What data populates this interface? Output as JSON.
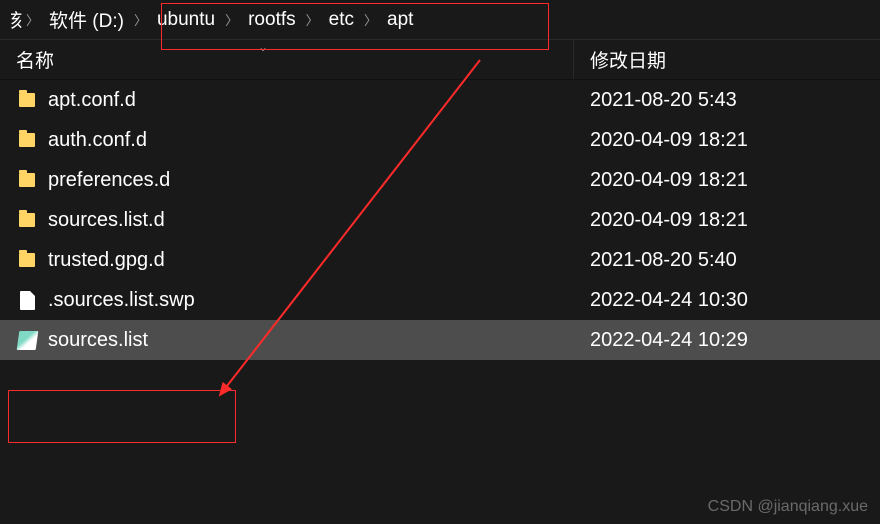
{
  "breadcrumb": {
    "items": [
      "刻",
      "软件 (D:)",
      "ubuntu",
      "rootfs",
      "etc",
      "apt"
    ]
  },
  "columns": {
    "name": "名称",
    "date": "修改日期"
  },
  "files": [
    {
      "name": "apt.conf.d",
      "date": "2021-08-20 5:43",
      "type": "folder",
      "selected": false
    },
    {
      "name": "auth.conf.d",
      "date": "2020-04-09 18:21",
      "type": "folder",
      "selected": false
    },
    {
      "name": "preferences.d",
      "date": "2020-04-09 18:21",
      "type": "folder",
      "selected": false
    },
    {
      "name": "sources.list.d",
      "date": "2020-04-09 18:21",
      "type": "folder",
      "selected": false
    },
    {
      "name": "trusted.gpg.d",
      "date": "2021-08-20 5:40",
      "type": "folder",
      "selected": false
    },
    {
      "name": ".sources.list.swp",
      "date": "2022-04-24 10:30",
      "type": "file",
      "selected": false
    },
    {
      "name": "sources.list",
      "date": "2022-04-24 10:29",
      "type": "notepad",
      "selected": true
    }
  ],
  "annotation": {
    "highlight_target": "sources.list",
    "arrow_color": "#ff2a2a"
  },
  "watermark": "CSDN @jianqiang.xue"
}
